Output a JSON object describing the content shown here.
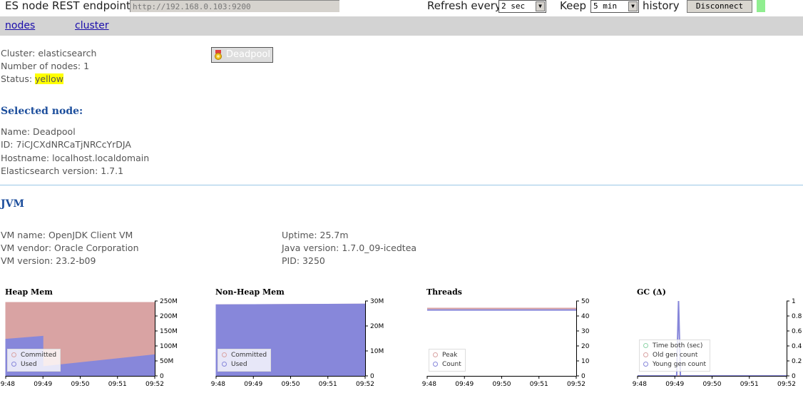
{
  "toolbar": {
    "endpoint_label": "ES node REST endpoint",
    "endpoint_value": "http://192.168.0.103:9200",
    "refresh_label": "Refresh every",
    "refresh_value": "2 sec",
    "keep_label": "Keep",
    "keep_value": "5 min",
    "history_label": "history",
    "disconnect_label": "Disconnect",
    "status_color": "#90ee90"
  },
  "nav": {
    "nodes": "nodes",
    "cluster": "cluster"
  },
  "cluster": {
    "cluster_line": "Cluster: elasticsearch",
    "nodes_line": "Number of nodes: 1",
    "status_label": "Status:",
    "status_value": "yellow",
    "node_button": "Deadpool"
  },
  "selected": {
    "heading": "Selected node:",
    "name": "Name: Deadpool",
    "id": "ID: 7iCJCXdNRCaTjNRCcYrDJA",
    "hostname": "Hostname: localhost.localdomain",
    "version": "Elasticsearch version: 1.7.1"
  },
  "jvm": {
    "heading": "JVM",
    "vm_name": "VM name: OpenJDK Client VM",
    "vm_vendor": "VM vendor: Oracle Corporation",
    "vm_version": "VM version: 23.2-b09",
    "uptime": "Uptime: 25.7m",
    "java_version": "Java version: 1.7.0_09-icedtea",
    "pid": "PID: 3250"
  },
  "chart_data": [
    {
      "type": "area",
      "title": "Heap Mem",
      "x": [
        "09:48",
        "09:49",
        "09:50",
        "09:51",
        "09:52"
      ],
      "y_ticks": [
        "0",
        "50M",
        "100M",
        "150M",
        "200M",
        "250M"
      ],
      "ylim": [
        0,
        255
      ],
      "series": [
        {
          "name": "Committed",
          "color": "#d9a3a3",
          "points": [
            [
              0,
              250
            ],
            [
              4,
              250
            ]
          ]
        },
        {
          "name": "Used",
          "color": "#8787da",
          "points": [
            [
              0,
              125
            ],
            [
              1,
              135
            ],
            [
              1,
              0
            ],
            [
              1.02,
              0
            ],
            [
              1.02,
              32
            ],
            [
              4,
              72
            ]
          ]
        }
      ],
      "legend": "bottom-left"
    },
    {
      "type": "area",
      "title": "Non-Heap Mem",
      "x": [
        "09:48",
        "09:49",
        "09:50",
        "09:51",
        "09:52"
      ],
      "y_ticks": [
        "0",
        "10M",
        "20M",
        "30M"
      ],
      "ylim": [
        0,
        30
      ],
      "series": [
        {
          "name": "Committed",
          "color": "#d9a3a3",
          "points": [
            [
              0,
              28.5
            ],
            [
              4,
              28.8
            ]
          ]
        },
        {
          "name": "Used",
          "color": "#8787da",
          "points": [
            [
              0,
              28.5
            ],
            [
              4,
              28.8
            ]
          ]
        }
      ],
      "legend": "bottom-left"
    },
    {
      "type": "line",
      "title": "Threads",
      "x": [
        "09:48",
        "09:49",
        "09:50",
        "09:51",
        "09:52"
      ],
      "y_ticks": [
        "0",
        "10",
        "20",
        "30",
        "40",
        "50"
      ],
      "ylim": [
        0,
        50
      ],
      "series": [
        {
          "name": "Peak",
          "color": "#d9a3a3",
          "points": [
            [
              0,
              45
            ],
            [
              4,
              45
            ]
          ]
        },
        {
          "name": "Count",
          "color": "#8787da",
          "points": [
            [
              0,
              44
            ],
            [
              4,
              44
            ]
          ]
        }
      ],
      "legend": "bottom-left"
    },
    {
      "type": "line",
      "title": "GC (Δ)",
      "x": [
        "09:48",
        "09:49",
        "09:50",
        "09:51",
        "09:52"
      ],
      "y_ticks": [
        "0",
        "0.2",
        "0.4",
        "0.6",
        "0.8",
        "1"
      ],
      "ylim": [
        0,
        1
      ],
      "series": [
        {
          "name": "Time both (sec)",
          "color": "#8fd3a8",
          "points": [
            [
              0,
              0
            ],
            [
              4,
              0
            ]
          ]
        },
        {
          "name": "Old gen count",
          "color": "#d9a3a3",
          "points": [
            [
              0,
              0
            ],
            [
              4,
              0
            ]
          ]
        },
        {
          "name": "Young gen count",
          "color": "#8787da",
          "points": [
            [
              0,
              0
            ],
            [
              1.05,
              0
            ],
            [
              1.1,
              1
            ],
            [
              1.15,
              0
            ],
            [
              4,
              0
            ]
          ]
        }
      ],
      "legend": "bottom-left"
    }
  ]
}
